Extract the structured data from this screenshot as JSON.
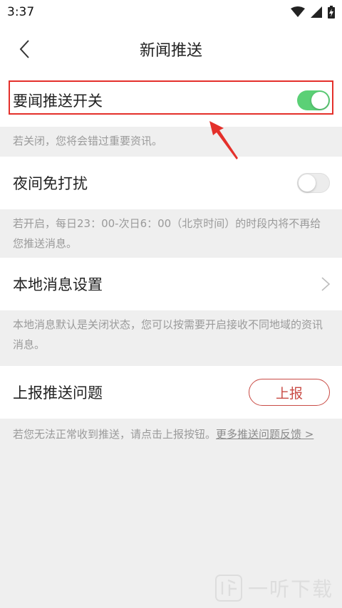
{
  "status_bar": {
    "time": "3:37",
    "icons": [
      "wifi-icon",
      "signal-icon",
      "battery-charging-icon"
    ]
  },
  "header": {
    "title": "新闻推送",
    "back_icon": "chevron-left-icon"
  },
  "settings": {
    "news_push": {
      "label": "要闻推送开关",
      "enabled": true,
      "note": "若关闭，您将会错过重要资讯。"
    },
    "night_mode": {
      "label": "夜间免打扰",
      "enabled": false,
      "note": "若开启，每日23：00-次日6：00（北京时间）的时段内将不再给您推送消息。"
    },
    "local_news": {
      "label": "本地消息设置",
      "note": "本地消息默认是关闭状态，您可以按需要开启接收不同地域的资讯消息。"
    },
    "report": {
      "label": "上报推送问题",
      "button_label": "上报",
      "note": "若您无法正常收到推送，请点击上报按钮。",
      "link_text": "更多推送问题反馈 >"
    }
  },
  "watermark": {
    "text": "一听下载"
  },
  "colors": {
    "toggle_on": "#5bd076",
    "accent_red": "#c94b45",
    "highlight_red": "#e4302b"
  }
}
